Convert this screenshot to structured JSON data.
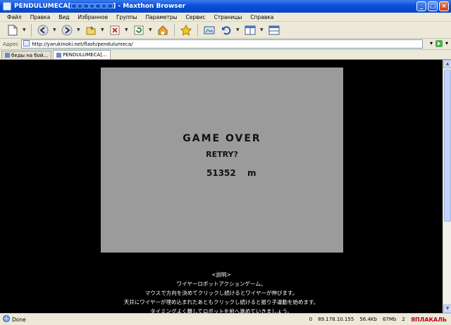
{
  "window": {
    "title": "PENDULUMECA[□□□□□□□] - Maxthon Browser"
  },
  "menu": [
    "Файл",
    "Правка",
    "Вид",
    "Избранное",
    "Группы",
    "Параметры",
    "Сервис",
    "Страницы",
    "Справка"
  ],
  "address": {
    "label": "Адрес",
    "url": "http://yarukinoki.net/flash/pendulumeca/"
  },
  "tabs": [
    {
      "label": "беды на бой...",
      "active": false
    },
    {
      "label": "PENDULUMECA[...",
      "active": true
    }
  ],
  "game": {
    "title": "GAME OVER",
    "retry": "RETRY?",
    "score": "51352",
    "unit": "m"
  },
  "description": {
    "heading": "<説明>",
    "line1": "ワイヤーロボットアクションゲーム。",
    "line2": "マウスで方向を決めてクリックし続けるとワイヤーが伸びます。",
    "line3": "天井にワイヤーが埋め込まれたあともクリックし続けると振り子運動を始めます。",
    "line4": "タイミングよく離してロボットを前へ進めていきましょう。"
  },
  "status": {
    "text": "Done",
    "count": "0",
    "ip": "89.178.10.155",
    "mem1": "56.4Kb",
    "mem2": "67Mb",
    "tabs_count": "2",
    "brand": "ЯПЛАКАЛЬ"
  },
  "icons": [
    "new-page-icon",
    "back-icon",
    "forward-icon",
    "open-icon",
    "stop-icon",
    "refresh-icon",
    "home-icon",
    "favorites-star-icon",
    "screen-icon",
    "undo-icon",
    "split-icon",
    "layout-icon"
  ]
}
